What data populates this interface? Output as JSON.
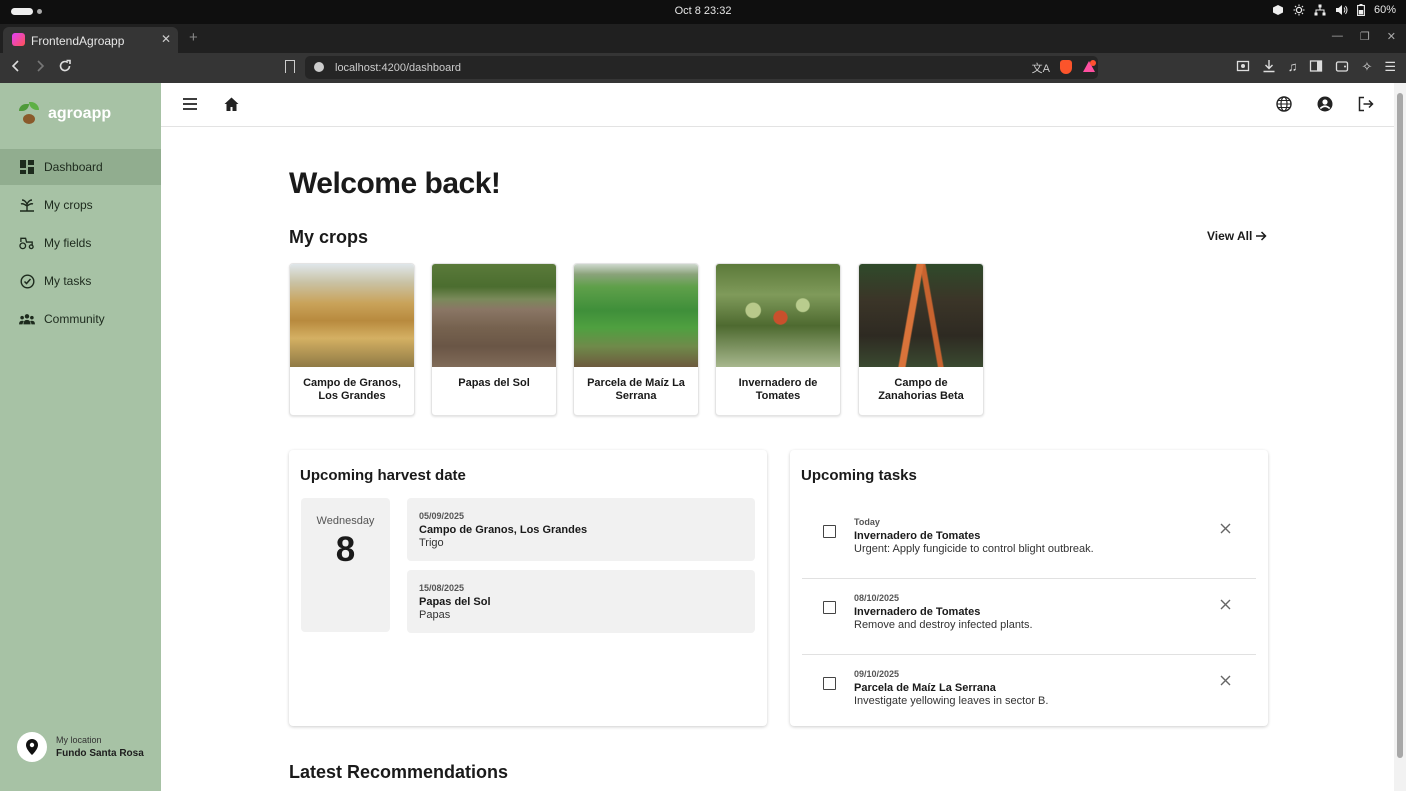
{
  "os": {
    "clock": "Oct 8  23:32",
    "battery": "60%"
  },
  "browser": {
    "tab_title": "FrontendAgroapp",
    "url": "localhost:4200/dashboard"
  },
  "sidebar": {
    "brand": "agroapp",
    "items": [
      {
        "label": "Dashboard",
        "icon": "dashboard-icon",
        "active": true
      },
      {
        "label": "My crops",
        "icon": "crop-icon",
        "active": false
      },
      {
        "label": "My fields",
        "icon": "tractor-icon",
        "active": false
      },
      {
        "label": "My tasks",
        "icon": "check-circle-icon",
        "active": false
      },
      {
        "label": "Community",
        "icon": "group-icon",
        "active": false
      }
    ],
    "location": {
      "label": "My location",
      "value": "Fundo Santa Rosa"
    }
  },
  "main": {
    "welcome": "Welcome back!",
    "crops_title": "My crops",
    "view_all": "View All",
    "crops": [
      {
        "name": "Campo de Granos, Los Grandes",
        "image": "wheat"
      },
      {
        "name": "Papas del Sol",
        "image": "plowed-field"
      },
      {
        "name": "Parcela de Maíz La Serrana",
        "image": "corn"
      },
      {
        "name": "Invernadero de Tomates",
        "image": "tomatoes"
      },
      {
        "name": "Campo de Zanahorias Beta",
        "image": "carrots"
      }
    ],
    "harvest": {
      "title": "Upcoming harvest date",
      "weekday": "Wednesday",
      "day": "8",
      "items": [
        {
          "date": "05/09/2025",
          "field": "Campo de Granos, Los Grandes",
          "crop": "Trigo"
        },
        {
          "date": "15/08/2025",
          "field": "Papas del Sol",
          "crop": "Papas"
        }
      ]
    },
    "tasks": {
      "title": "Upcoming tasks",
      "items": [
        {
          "when": "Today",
          "field": "Invernadero de Tomates",
          "desc": "Urgent: Apply fungicide to control blight outbreak."
        },
        {
          "when": "08/10/2025",
          "field": "Invernadero de Tomates",
          "desc": "Remove and destroy infected plants."
        },
        {
          "when": "09/10/2025",
          "field": "Parcela de Maíz La Serrana",
          "desc": "Investigate yellowing leaves in sector B."
        }
      ]
    },
    "recommendations_title": "Latest Recommendations"
  }
}
